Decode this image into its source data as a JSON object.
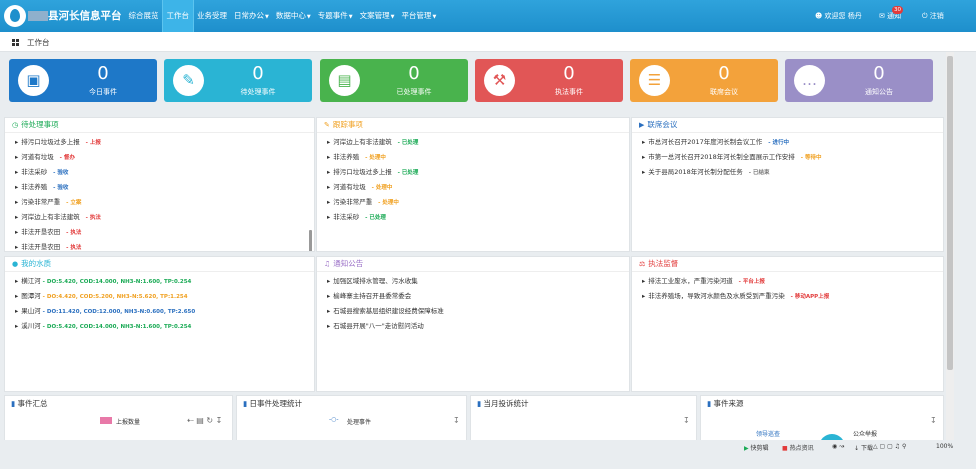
{
  "header": {
    "title": "县河长信息平台",
    "nav": [
      {
        "label": "综合展览",
        "dropdown": false,
        "active": false
      },
      {
        "label": "工作台",
        "dropdown": false,
        "active": true
      },
      {
        "label": "业务受理",
        "dropdown": false,
        "active": false
      },
      {
        "label": "日常办公",
        "dropdown": true,
        "active": false
      },
      {
        "label": "数据中心",
        "dropdown": true,
        "active": false
      },
      {
        "label": "专题事件",
        "dropdown": true,
        "active": false
      },
      {
        "label": "文案管理",
        "dropdown": true,
        "active": false
      },
      {
        "label": "平台管理",
        "dropdown": true,
        "active": false
      }
    ],
    "welcome": "欢迎您",
    "user": "杨丹",
    "notice_label": "通知",
    "notice_count": "30",
    "logout": "注销"
  },
  "breadcrumb": "工作台",
  "tiles": [
    {
      "count": "0",
      "label": "今日事件",
      "color": "#1e78c8",
      "icon": "presentation-icon"
    },
    {
      "count": "0",
      "label": "待处理事件",
      "color": "#2ab4d4",
      "icon": "edit-icon"
    },
    {
      "count": "0",
      "label": "已处理事件",
      "color": "#49b34d",
      "icon": "money-icon"
    },
    {
      "count": "0",
      "label": "执法事件",
      "color": "#e15656",
      "icon": "gavel-icon"
    },
    {
      "count": "0",
      "label": "联席会议",
      "color": "#f3a23b",
      "icon": "document-icon"
    },
    {
      "count": "0",
      "label": "通知公告",
      "color": "#9a8fc7",
      "icon": "chat-icon"
    }
  ],
  "pending": {
    "title": "待处理事项",
    "items": [
      {
        "text": "排污口垃圾过多上报",
        "tag": "上报",
        "color": "#e23b3b"
      },
      {
        "text": "河道有垃圾",
        "tag": "督办",
        "color": "#e23b3b"
      },
      {
        "text": "非法采砂",
        "tag": "验收",
        "color": "#2a6fbf"
      },
      {
        "text": "非法养殖",
        "tag": "验收",
        "color": "#2a6fbf"
      },
      {
        "text": "污染非常严重",
        "tag": "立案",
        "color": "#f0a020"
      },
      {
        "text": "河岸边上有非法建筑",
        "tag": "执法",
        "color": "#e23b3b"
      },
      {
        "text": "非法开垦农田",
        "tag": "执法",
        "color": "#e23b3b"
      },
      {
        "text": "非法开垦农田",
        "tag": "执法",
        "color": "#e23b3b"
      }
    ]
  },
  "tracking": {
    "title": "跟踪事项",
    "items": [
      {
        "text": "河岸边上有非法建筑",
        "tag": "已处理",
        "color": "#1aaa55"
      },
      {
        "text": "非法养殖",
        "tag": "处理中",
        "color": "#f0a020"
      },
      {
        "text": "排污口垃圾过多上报",
        "tag": "已处理",
        "color": "#1aaa55"
      },
      {
        "text": "河道有垃圾",
        "tag": "处理中",
        "color": "#f0a020"
      },
      {
        "text": "污染非常严重",
        "tag": "处理中",
        "color": "#f0a020"
      },
      {
        "text": "非法采砂",
        "tag": "已处理",
        "color": "#1aaa55"
      }
    ]
  },
  "meetings": {
    "title": "联席会议",
    "items": [
      {
        "text": "市总河长召开2017年度河长制会议工作",
        "tag": "进行中",
        "color": "#2a6fbf"
      },
      {
        "text": "市第一总河长召开2018年河长制全面展示工作安排",
        "tag": "等待中",
        "color": "#f0a020"
      },
      {
        "text": "关于县局2018年河长制分配任务",
        "tag": "已结束",
        "color": "#777777"
      }
    ]
  },
  "water": {
    "title": "我的水质",
    "items": [
      {
        "name": "横江河",
        "do": "DO:5.420",
        "cod": "COD:14.000",
        "nh3": "NH3-N:1.600",
        "tp": "TP:0.254",
        "color": "#1aaa55"
      },
      {
        "name": "图潭河",
        "do": "DO:4.420",
        "cod": "COD:5.200",
        "nh3": "NH3-N:5.620",
        "tp": "TP:1.254",
        "color": "#f0a020"
      },
      {
        "name": "果山河",
        "do": "DO:11.420",
        "cod": "COD:12.000",
        "nh3": "NH3-N:0.600",
        "tp": "TP:2.650",
        "color": "#2a6fbf"
      },
      {
        "name": "溪川河",
        "do": "DO:5.420",
        "cod": "COD:14.000",
        "nh3": "NH3-N:1.600",
        "tp": "TP:0.254",
        "color": "#1aaa55"
      }
    ]
  },
  "notices": {
    "title": "通知公告",
    "items": [
      "加强区域排水管理、污水收集",
      "榆峰寨主持召开县委常委会",
      "石城县搜索基层组织建设经费保障标准",
      "石城县开展\"八一\"走访慰问活动"
    ]
  },
  "enforcement": {
    "title": "执法监督",
    "items": [
      {
        "text": "排法工业废水，严重污染河道",
        "tag": "平台上报",
        "color": "#e23b3b"
      },
      {
        "text": "非法养殖场，导致河水颜色及水质受到严重污染",
        "tag": "移动APP上报",
        "color": "#e23b3b"
      }
    ]
  },
  "bottom": {
    "summary_title": "事件汇总",
    "summary_legend": "上报数量",
    "daily_title": "日事件处理统计",
    "daily_legend": "处理事件",
    "monthly_title": "当月投诉统计",
    "source_title": "事件来源",
    "source_label_left": "领导巡查",
    "source_label_right": "公众举报"
  },
  "statusbar": {
    "a": "快剪辑",
    "b": "热点资讯",
    "c": "下载",
    "zoom": "100%"
  }
}
